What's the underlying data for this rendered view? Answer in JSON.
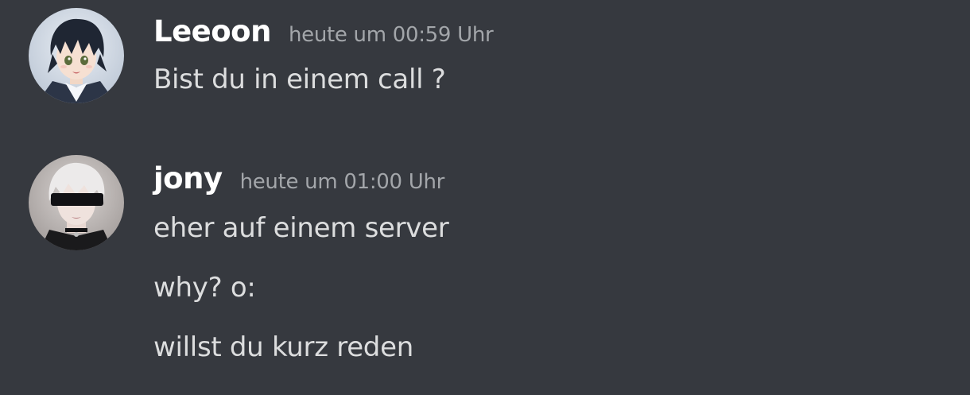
{
  "messages": [
    {
      "author": "Leeoon",
      "timestamp": "heute um 00:59 Uhr",
      "lines": [
        "Bist du in einem call ?"
      ]
    },
    {
      "author": "jony",
      "timestamp": "heute um 01:00 Uhr",
      "lines": [
        "eher auf einem server",
        "why? o:",
        "willst du kurz reden"
      ]
    }
  ],
  "colors": {
    "background": "#36393f",
    "username": "#ffffff",
    "timestamp": "#a3a6aa",
    "message_text": "#dcddde"
  }
}
